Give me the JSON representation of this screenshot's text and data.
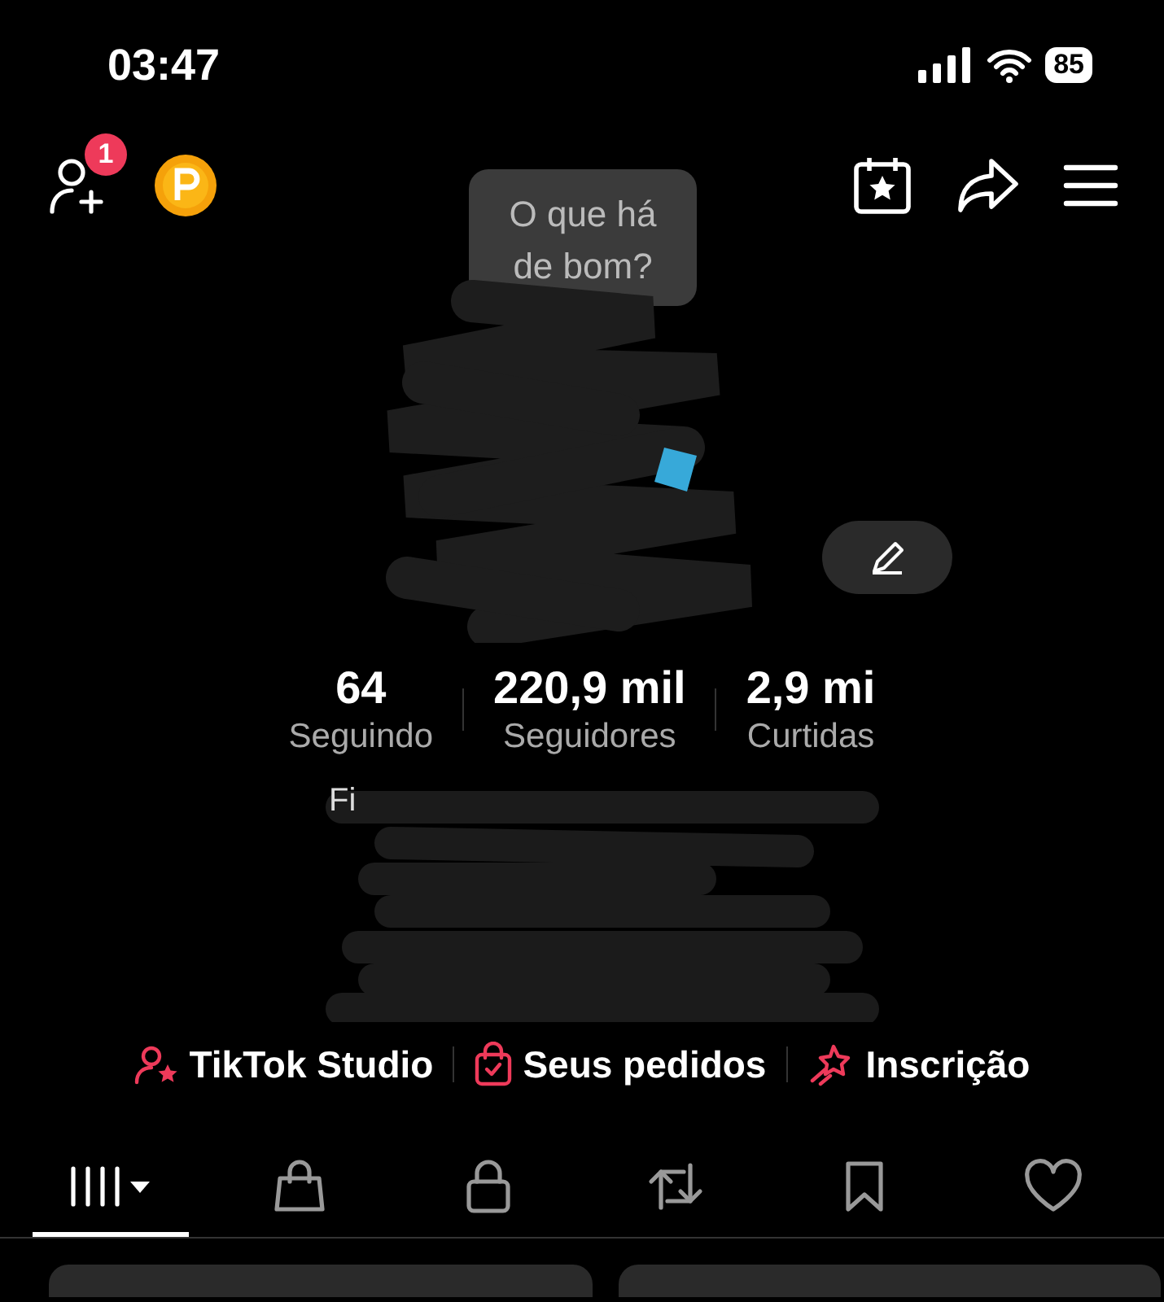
{
  "status_bar": {
    "time": "03:47",
    "battery": "85"
  },
  "header": {
    "friend_requests_badge": "1"
  },
  "bubble": {
    "lines": [
      "O que há",
      "de bom?"
    ]
  },
  "stats": [
    {
      "value": "64",
      "label": "Seguindo"
    },
    {
      "value": "220,9 mil",
      "label": "Seguidores"
    },
    {
      "value": "2,9 mi",
      "label": "Curtidas"
    }
  ],
  "bio": {
    "visible_start": "Fi"
  },
  "links": [
    {
      "kind": "studio",
      "label": "TikTok Studio"
    },
    {
      "kind": "orders",
      "label": "Seus pedidos"
    },
    {
      "kind": "subscription",
      "label": "Inscrição"
    }
  ],
  "tabs": [
    {
      "kind": "videos",
      "selected": true
    },
    {
      "kind": "shop",
      "selected": false
    },
    {
      "kind": "private",
      "selected": false
    },
    {
      "kind": "reposts",
      "selected": false
    },
    {
      "kind": "saved",
      "selected": false
    },
    {
      "kind": "liked",
      "selected": false
    }
  ]
}
